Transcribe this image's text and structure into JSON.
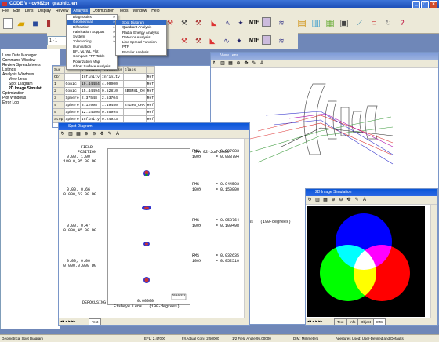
{
  "app": {
    "title": "CODE V - cv982pr_graphic.len",
    "menu": [
      "File",
      "Edit",
      "Lens",
      "Display",
      "Review",
      "Analysis",
      "Optimization",
      "Tools",
      "Window",
      "Help"
    ],
    "active_menu": "Analysis"
  },
  "toolbar": {
    "mtf_label": "MTF",
    "mtf_label2": "MTF",
    "surface_field": "1 - 1"
  },
  "analysis_menu": {
    "items": [
      {
        "label": "Diagnostics",
        "sub": true
      },
      {
        "label": "Geometrical",
        "sub": true,
        "highlight": true
      },
      {
        "label": "Diffraction",
        "sub": true
      },
      {
        "label": "Fabrication Support",
        "sub": true
      },
      {
        "label": "System",
        "sub": true
      },
      {
        "label": "Tolerancing",
        "sub": true
      },
      {
        "label": "Illumination",
        "sub": false
      },
      {
        "label": "BFL vs. WL Plot",
        "sub": false
      },
      {
        "label": "Compact PFP Table",
        "sub": false
      },
      {
        "label": "Polarization Map",
        "sub": false
      },
      {
        "label": "Ghost Surface Analysis",
        "sub": false
      }
    ]
  },
  "geometrical_menu": {
    "items": [
      {
        "label": "Spot Diagram",
        "highlight": true
      },
      {
        "label": "Quadrant Analysis"
      },
      {
        "label": "Radial Energy Analysis"
      },
      {
        "label": "Detector Analysis"
      },
      {
        "label": "Line Spread Function"
      },
      {
        "label": "PTF"
      },
      {
        "label": "Bezular Analysis"
      }
    ]
  },
  "tree": [
    {
      "label": "Lens Data Manager",
      "indent": 0
    },
    {
      "label": "Command Window",
      "indent": 0
    },
    {
      "label": "Review Spreadsheets",
      "indent": 0
    },
    {
      "label": "Listings",
      "indent": 0
    },
    {
      "label": "Analysis Windows",
      "indent": 0
    },
    {
      "label": "View Lens",
      "indent": 1
    },
    {
      "label": "Spot Diagram",
      "indent": 1
    },
    {
      "label": "2D Image Simulat",
      "indent": 1,
      "bold": true
    },
    {
      "label": "Optimization",
      "indent": 0
    },
    {
      "label": "Plot Windows",
      "indent": 0
    },
    {
      "label": "Error Log",
      "indent": 0
    }
  ],
  "lde": {
    "headers": [
      "Sur",
      "",
      "Y Radius",
      "Thickness",
      "Glass",
      ""
    ],
    "rows": [
      [
        "Obj",
        "",
        "Infinity",
        "Infinity",
        "",
        "Ref"
      ],
      [
        "1",
        "Conic",
        "19.44484",
        "4.00000",
        "",
        "Ref"
      ],
      [
        "2",
        "Conic",
        "15.44494",
        "0.52810",
        "SBSM81_OH",
        "Ref"
      ],
      [
        "3",
        "Sphere",
        "2.37548",
        "2.53704",
        "",
        "Ref"
      ],
      [
        "4",
        "Sphere",
        "3.12998",
        "1.19450",
        "STIH6_OHA",
        "Ref"
      ],
      [
        "5",
        "Sphere",
        "12.14306",
        "0.85994",
        "",
        "Ref"
      ],
      [
        "Stop",
        "Sphere",
        "Infinity",
        "0.24923",
        "",
        "Ref"
      ]
    ]
  },
  "spot_window": {
    "title": "Spot Diagram",
    "field_label": "FIELD",
    "position_label": "POSITION",
    "oha": "OHA 02-Jun-2008",
    "fields": [
      {
        "pos1": "0.00, 1.00",
        "pos2": "180.0,95.00 DG",
        "rms_label": "RMS",
        "rms": "= 0.037083",
        "pct_label": "100%",
        "pct": "= 0.088794"
      },
      {
        "pos1": "0.00, 0.66",
        "pos2": "0.000,63.00 DG",
        "rms_label": "RMS",
        "rms": "= 0.044503",
        "pct_label": "100%",
        "pct": "= 0.150800"
      },
      {
        "pos1": "0.00, 0.47",
        "pos2": "0.000,45.00 DG",
        "rms_label": "RMS",
        "rms": "= 0.053764",
        "pct_label": "100%",
        "pct": "= 0.109498"
      },
      {
        "pos1": "0.00, 0.00",
        "pos2": "0.000,0.000 DG",
        "rms_label": "RMS",
        "rms": "= 0.032635",
        "pct_label": "100%",
        "pct": "= 0.052510"
      }
    ],
    "scale_label": "SCALE=0.1",
    "defocusing_label": "DEFOCUSING",
    "defocusing_value": "0.00000",
    "lens_name": "Fisheye Lens",
    "lens_desc": "(190-degrees)",
    "tab": "Text"
  },
  "view_lens": {
    "title": "View Lens",
    "caption": "ns",
    "caption2": "(190-degrees)"
  },
  "image_sim": {
    "title": "2D Image Simulation",
    "tabs": [
      "Text",
      "Info",
      "Object",
      "IMS"
    ],
    "selected_tab": "IMS",
    "colors": {
      "red": "#ff0000",
      "green": "#00ff00",
      "blue": "#0000ff"
    }
  },
  "status": {
    "left": "Geometrical Spot Diagram",
    "efl": "EFL: 2.47000",
    "fno": "F/(Actual Conj) 2.50000",
    "half_field": "1/2 Field Angle 95.00000",
    "dim": "DIM: Millimeters",
    "apertures": "Apertures Used: User-Defined and Defaults"
  }
}
